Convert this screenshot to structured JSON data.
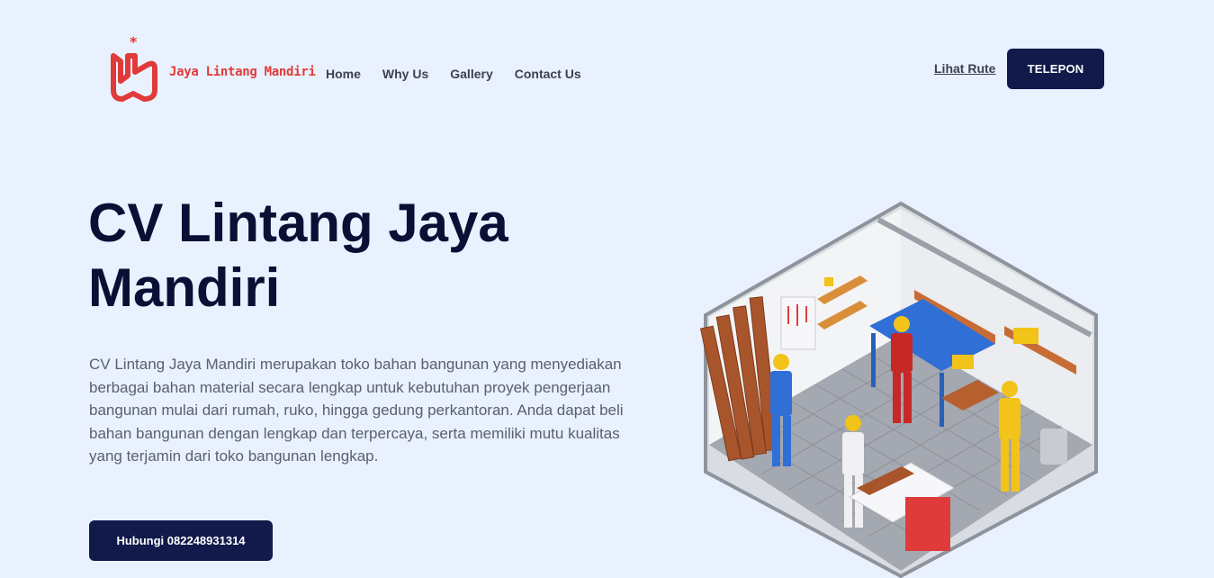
{
  "header": {
    "logo_text": "Jaya Lintang Mandiri",
    "nav": [
      {
        "label": "Home"
      },
      {
        "label": "Why Us"
      },
      {
        "label": "Gallery"
      },
      {
        "label": "Contact Us"
      }
    ],
    "route_label": "Lihat Rute",
    "call_label": "TELEPON"
  },
  "hero": {
    "title": "CV Lintang Jaya Mandiri",
    "description": "CV Lintang Jaya Mandiri merupakan toko bahan bangunan yang menyediakan berbagai bahan material secara lengkap untuk kebutuhan proyek pengerjaan bangunan mulai dari rumah, ruko, hingga gedung perkantoran. Anda dapat beli bahan bangunan dengan lengkap dan terpercaya, serta memiliki mutu kualitas yang terjamin dari toko bangunan lengkap.",
    "cta_label": "Hubungi 082248931314"
  },
  "colors": {
    "background": "#e8f1fd",
    "primary": "#111a4b",
    "brand_red": "#e03b3b",
    "title": "#0a1035"
  },
  "illustration": {
    "icon": "workshop-illustration"
  }
}
